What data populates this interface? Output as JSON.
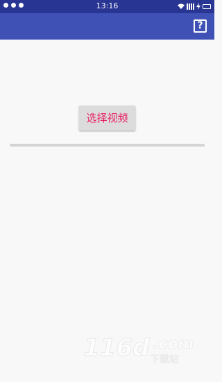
{
  "status_bar": {
    "time": "13:16",
    "left_icons": [
      "notification-icon",
      "notification-icon",
      "alarm-icon"
    ],
    "right_icons": [
      "wifi-icon",
      "signal-icon",
      "charging-icon",
      "battery-icon"
    ]
  },
  "app_bar": {
    "help_label": "?",
    "color": "#3f51b5",
    "status_color": "#283593"
  },
  "main": {
    "select_video_label": "选择视频",
    "button_text_color": "#e91e63",
    "progress": 0
  },
  "watermark": {
    "text": "116d.com",
    "subtext": "下载站"
  }
}
